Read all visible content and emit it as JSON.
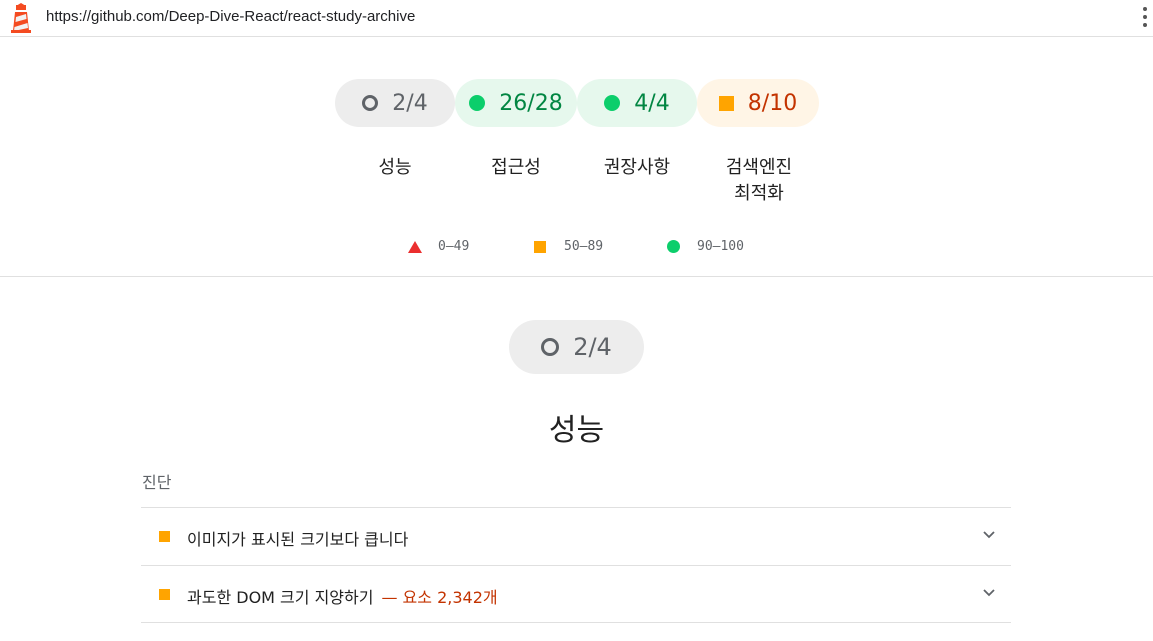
{
  "address_bar": {
    "url": "https://github.com/Deep-Dive-React/react-study-archive"
  },
  "gauges": [
    {
      "score": "2/4",
      "label": "성능",
      "status": "neutral"
    },
    {
      "score": "26/28",
      "label": "접근성",
      "status": "pass"
    },
    {
      "score": "4/4",
      "label": "권장사항",
      "status": "pass"
    },
    {
      "score": "8/10",
      "label_line1": "검색엔진",
      "label_line2": "최적화",
      "status": "average"
    }
  ],
  "legend": {
    "fail": "0–49",
    "average": "50–89",
    "pass": "90–100"
  },
  "section": {
    "score": "2/4",
    "title": "성능",
    "group_label": "진단",
    "audits": [
      {
        "title": "이미지가 표시된 크기보다 큽니다",
        "extra": ""
      },
      {
        "title": "과도한 DOM 크기 지양하기",
        "extra": "— 요소 2,342개"
      }
    ]
  },
  "colors": {
    "pass": "#0cce6b",
    "average": "#ffa400",
    "fail": "#eb2f2f",
    "neutral": "#5f6368"
  }
}
